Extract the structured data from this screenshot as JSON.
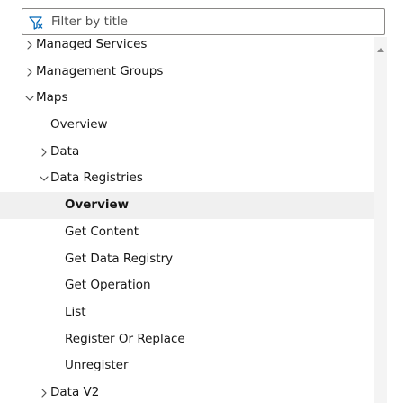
{
  "filter": {
    "placeholder": "Filter by title",
    "icon": "filter-icon"
  },
  "tree": [
    {
      "id": "managed-services",
      "label": "Managed Services",
      "level": 0,
      "chevron": "right"
    },
    {
      "id": "management-groups",
      "label": "Management Groups",
      "level": 0,
      "chevron": "right"
    },
    {
      "id": "maps",
      "label": "Maps",
      "level": 0,
      "chevron": "down"
    },
    {
      "id": "maps-overview",
      "label": "Overview",
      "level": 1,
      "chevron": ""
    },
    {
      "id": "data",
      "label": "Data",
      "level": 1,
      "chevron": "right"
    },
    {
      "id": "data-registries",
      "label": "Data Registries",
      "level": 1,
      "chevron": "down"
    },
    {
      "id": "data-registries-overview",
      "label": "Overview",
      "level": 2,
      "chevron": "",
      "selected": true
    },
    {
      "id": "get-content",
      "label": "Get Content",
      "level": 2,
      "chevron": ""
    },
    {
      "id": "get-data-registry",
      "label": "Get Data Registry",
      "level": 2,
      "chevron": ""
    },
    {
      "id": "get-operation",
      "label": "Get Operation",
      "level": 2,
      "chevron": ""
    },
    {
      "id": "list",
      "label": "List",
      "level": 2,
      "chevron": ""
    },
    {
      "id": "register-or-replace",
      "label": "Register Or Replace",
      "level": 2,
      "chevron": ""
    },
    {
      "id": "unregister",
      "label": "Unregister",
      "level": 2,
      "chevron": ""
    },
    {
      "id": "data-v2",
      "label": "Data V2",
      "level": 1,
      "chevron": "right"
    }
  ],
  "colors": {
    "accent": "#0067b8",
    "selected_bg": "#f0f0f0",
    "text": "#161616"
  }
}
